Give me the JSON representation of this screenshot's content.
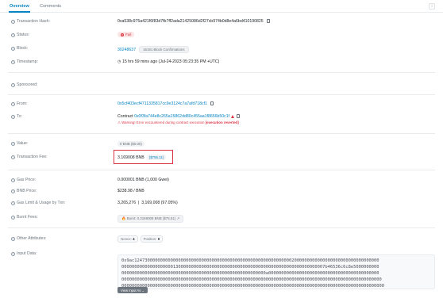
{
  "tabs": {
    "overview": "Overview",
    "comments": "Comments",
    "more": "⁝"
  },
  "rows": {
    "tx_hash": {
      "label": "Transaction Hash:",
      "value": "0xa538c975a421f6f83d7fb7ff2ada21425086d2f27cb974b0d8e4a6bd410190825"
    },
    "status": {
      "label": "Status:",
      "value": "Fail"
    },
    "block": {
      "label": "Block:",
      "value": "30248637",
      "confirmations": "16191 Block Confirmations"
    },
    "timestamp": {
      "label": "Timestamp:",
      "value": "15 hrs 59 mins ago (Jul-24-2023 05:23:35 PM +UTC)"
    },
    "sponsored": {
      "label": "Sponsored:"
    },
    "from": {
      "label": "From:",
      "value": "0x5cf403ecf4711335817cc9e3124c7a7afd718cf1"
    },
    "to": {
      "label": "To:",
      "prefix": "Contract",
      "value": "0x0f3fa744e8c265a15862dd80c455aa1f8656b50c1f",
      "warning_pre": "Warning! Error encountered during contract execution",
      "warning_bold": "[execution reverted]"
    },
    "value": {
      "label": "Value:",
      "value": "0 BNB ($0.00)"
    },
    "fee": {
      "label": "Transaction Fee:",
      "value": "3.169008 BNB",
      "usd": "($755.11)"
    },
    "gas_price": {
      "label": "Gas Price:",
      "value": "0.000001 BNB (1,000 Gwei)"
    },
    "bnb_price": {
      "label": "BNB Price:",
      "value": "$238.98 / BNB"
    },
    "gas_limit": {
      "label": "Gas Limit & Usage by Txn:",
      "value": "3,265,276  |  3,169,008 (97.05%)"
    },
    "burnt": {
      "label": "Burnt Fees:",
      "value": "Burnt: 0.3169008 BNB ($75.51)"
    },
    "attributes": {
      "label": "Other Attributes:",
      "nonce_label": "Nonce:",
      "nonce": "4",
      "position_label": "Position:",
      "position": "0"
    },
    "input": {
      "label": "Input Data:",
      "lines": [
        "0x9ac12473000000000000000000000000000000000000000000000000000000002000000000000000000000000000000000",
        "0000000000000000000013000000000000000000000000000000000000000000000000000000007b46536c6c8e5000000000",
        "00000000000000000000000000000000000000000000000000000000a0000000000000000000000000000000000000000000",
        "00000000000000000000000000000000000000000000000000000000000000000000000000000000000000000000000000000",
        "000000000000000000000000000000000000000000000000000000000000000000000000000000000000000000000000000000"
      ],
      "button": "View Input As ⌄"
    }
  }
}
